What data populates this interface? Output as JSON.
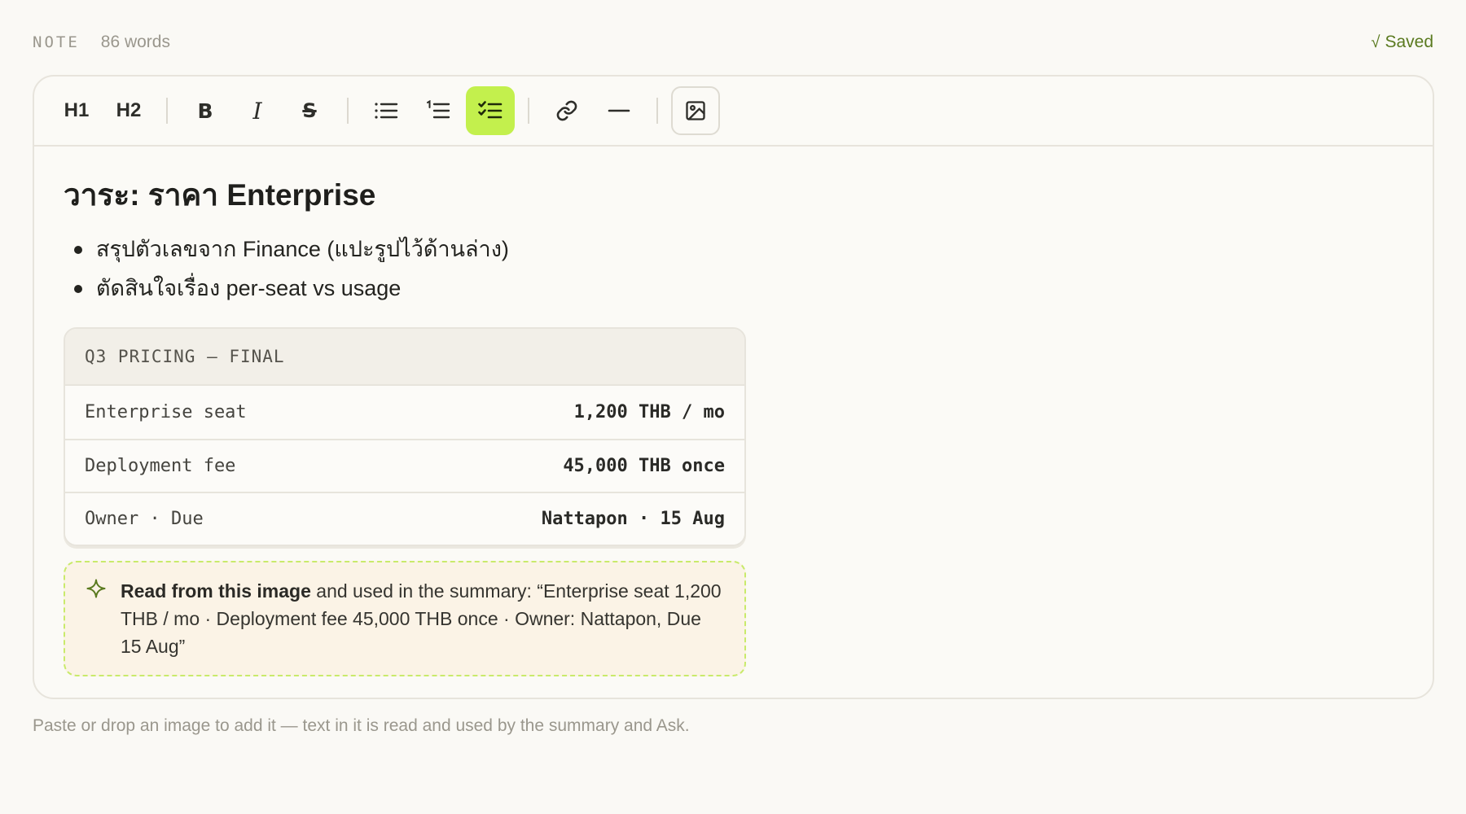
{
  "header": {
    "tag": "NOTE",
    "word_count": "86 words",
    "saved_icon": "√",
    "saved_label": "Saved"
  },
  "toolbar": {
    "h1_label": "H1",
    "h2_label": "H2",
    "bold_label": "B",
    "italic_label": "I",
    "strike_label": "S",
    "active_tool": "checklist",
    "icons": [
      "bullet-list-icon",
      "numbered-list-icon",
      "checklist-icon",
      "link-icon",
      "horizontal-rule-icon",
      "image-icon"
    ],
    "accent_color": "#c3f04d"
  },
  "document": {
    "title": "วาระ: ราคา Enterprise",
    "bullets": [
      "สรุปตัวเลขจาก Finance (แปะรูปไว้ด้านล่าง)",
      "ตัดสินใจเรื่อง per-seat vs usage"
    ],
    "image": {
      "heading": "Q3 PRICING — FINAL",
      "rows": [
        {
          "label": "Enterprise seat",
          "value": "1,200 THB / mo"
        },
        {
          "label": "Deployment fee",
          "value": "45,000 THB once"
        },
        {
          "label": "Owner · Due",
          "value": "Nattapon · 15 Aug"
        }
      ]
    },
    "ocr_note": {
      "lead": "Read from this image",
      "text": " and used in the summary: “Enterprise seat 1,200 THB / mo · Deployment fee 45,000 THB once · Owner: Nattapon, Due 15 Aug”"
    }
  },
  "footer": {
    "hint": "Paste or drop an image to add it — text in it is read and used by the summary and Ask."
  }
}
